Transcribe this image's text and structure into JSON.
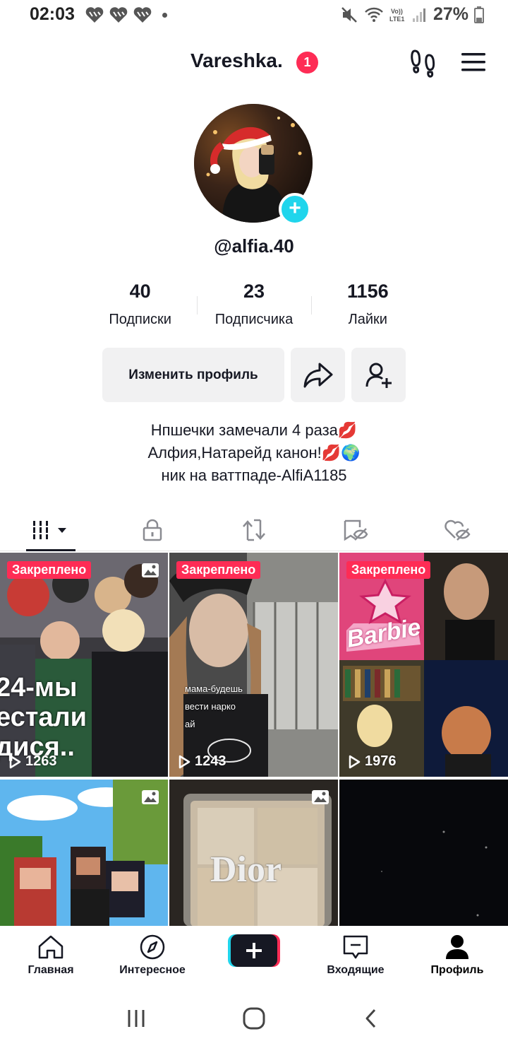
{
  "status_bar": {
    "time": "02:03",
    "battery": "27%",
    "network_label": "Vo)) LTE1"
  },
  "header": {
    "title": "Vareshka.",
    "notification_count": "1"
  },
  "profile": {
    "handle": "@alfia.40",
    "stats": [
      {
        "value": "40",
        "label": "Подписки"
      },
      {
        "value": "23",
        "label": "Подписчика"
      },
      {
        "value": "1156",
        "label": "Лайки"
      }
    ],
    "edit_button": "Изменить профиль",
    "bio": [
      "Нпшечки замечали 4 раза💋",
      "Алфия,Натарейд канон!💋🌍",
      "ник на ваттпаде-AlfiA1185"
    ]
  },
  "tabs": [
    {
      "icon": "grid-icon",
      "active": true
    },
    {
      "icon": "lock-icon",
      "active": false
    },
    {
      "icon": "repost-icon",
      "active": false
    },
    {
      "icon": "saved-icon",
      "active": false
    },
    {
      "icon": "liked-hidden-icon",
      "active": false
    }
  ],
  "videos": [
    {
      "pinned": "Закреплено",
      "views": "1263",
      "caption": "24-мы\nестали\nдися..",
      "photo": true
    },
    {
      "pinned": "Закреплено",
      "views": "1243",
      "caption": "мама-будешь\nвести нарко\nай",
      "photo": false
    },
    {
      "pinned": "Закреплено",
      "views": "1976",
      "caption": "Barbie",
      "photo": false
    },
    {
      "pinned": "",
      "views": "",
      "caption": "",
      "photo": true
    },
    {
      "pinned": "",
      "views": "",
      "caption": "Dior",
      "photo": true
    },
    {
      "pinned": "",
      "views": "",
      "caption": "",
      "photo": false
    }
  ],
  "bottom_nav": [
    {
      "label": "Главная",
      "icon": "home-icon"
    },
    {
      "label": "Интересное",
      "icon": "compass-icon"
    },
    {
      "label": "",
      "icon": "create-icon"
    },
    {
      "label": "Входящие",
      "icon": "inbox-icon"
    },
    {
      "label": "Профиль",
      "icon": "profile-icon"
    }
  ],
  "colors": {
    "accent": "#fe2c55",
    "cyan": "#20d5ec",
    "text": "#161823",
    "button_bg": "#f1f1f2"
  }
}
